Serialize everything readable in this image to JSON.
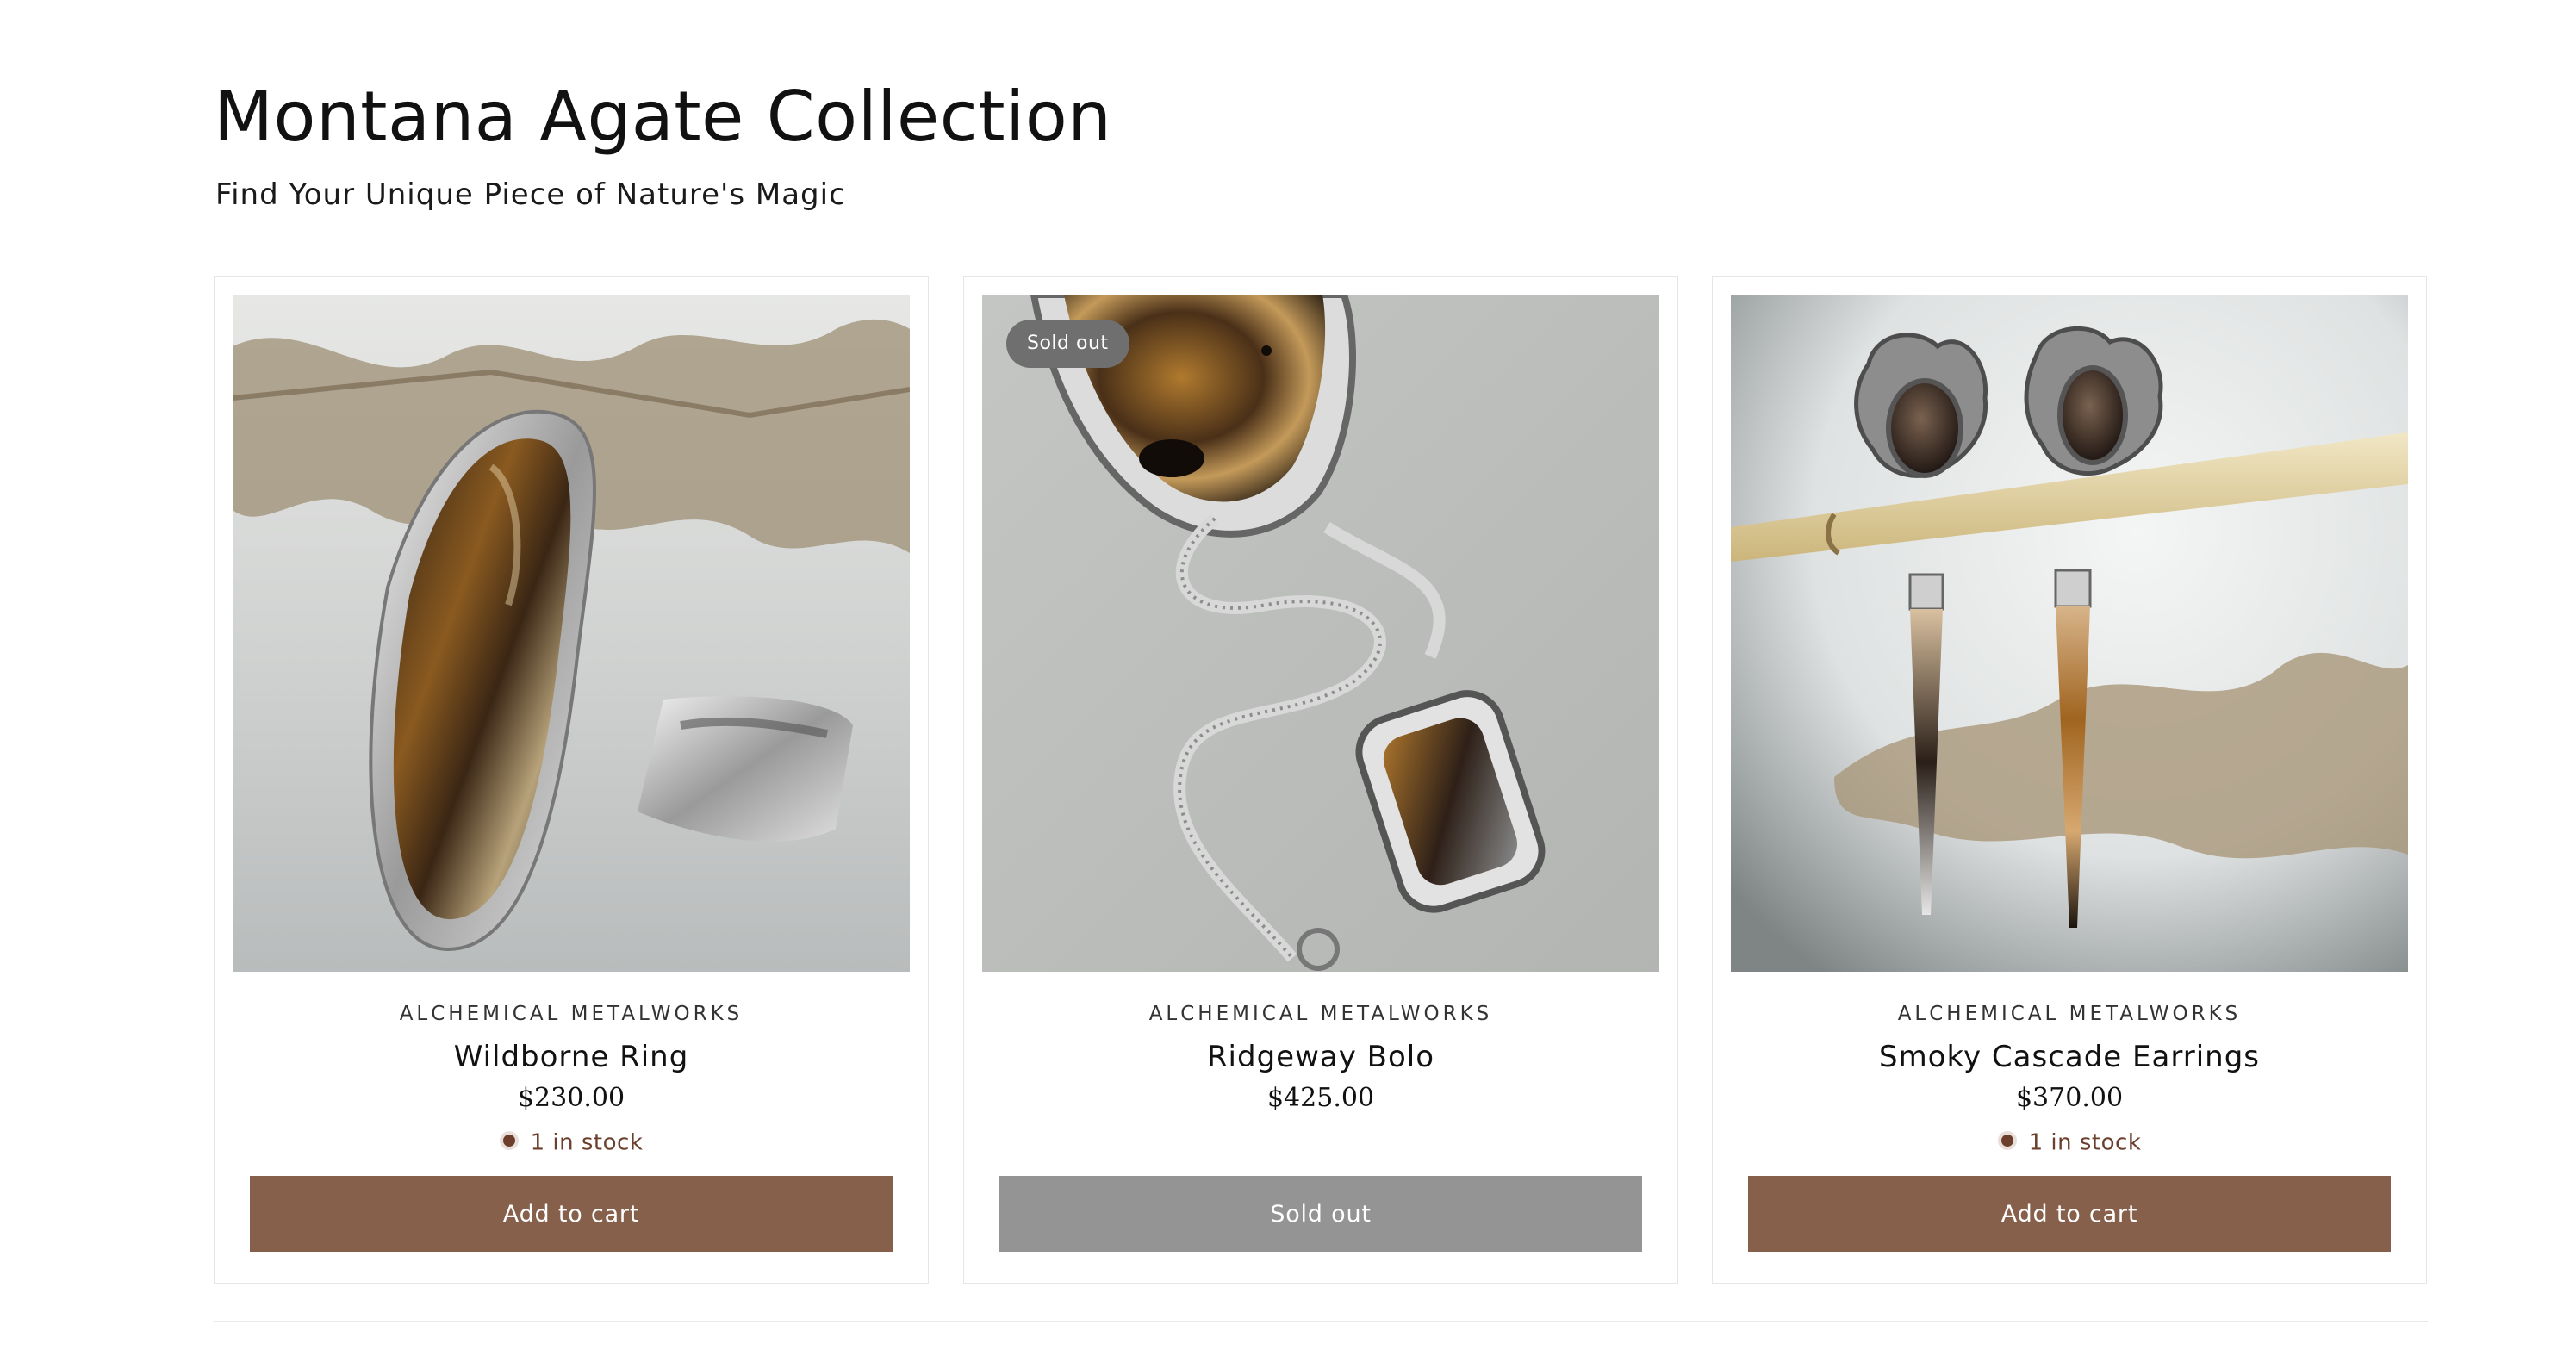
{
  "collection": {
    "title": "Montana Agate Collection",
    "subtitle": "Find Your Unique Piece of Nature's Magic"
  },
  "colors": {
    "accent": "#87604c",
    "sold_out_button": "#949494",
    "stock_indicator": "#6b3f2c",
    "badge": "#6f6f6f"
  },
  "products": [
    {
      "vendor": "ALCHEMICAL METALWORKS",
      "title": "Wildborne Ring",
      "price": "$230.00",
      "stock": "1 in stock",
      "button": "Add to cart",
      "image": "agate-ring-photo"
    },
    {
      "vendor": "ALCHEMICAL METALWORKS",
      "title": "Ridgeway Bolo",
      "price": "$425.00",
      "badge": "Sold out",
      "button": "Sold out",
      "image": "agate-bolo-photo"
    },
    {
      "vendor": "ALCHEMICAL METALWORKS",
      "title": "Smoky Cascade Earrings",
      "price": "$370.00",
      "stock": "1 in stock",
      "button": "Add to cart",
      "image": "agate-earrings-photo"
    }
  ]
}
